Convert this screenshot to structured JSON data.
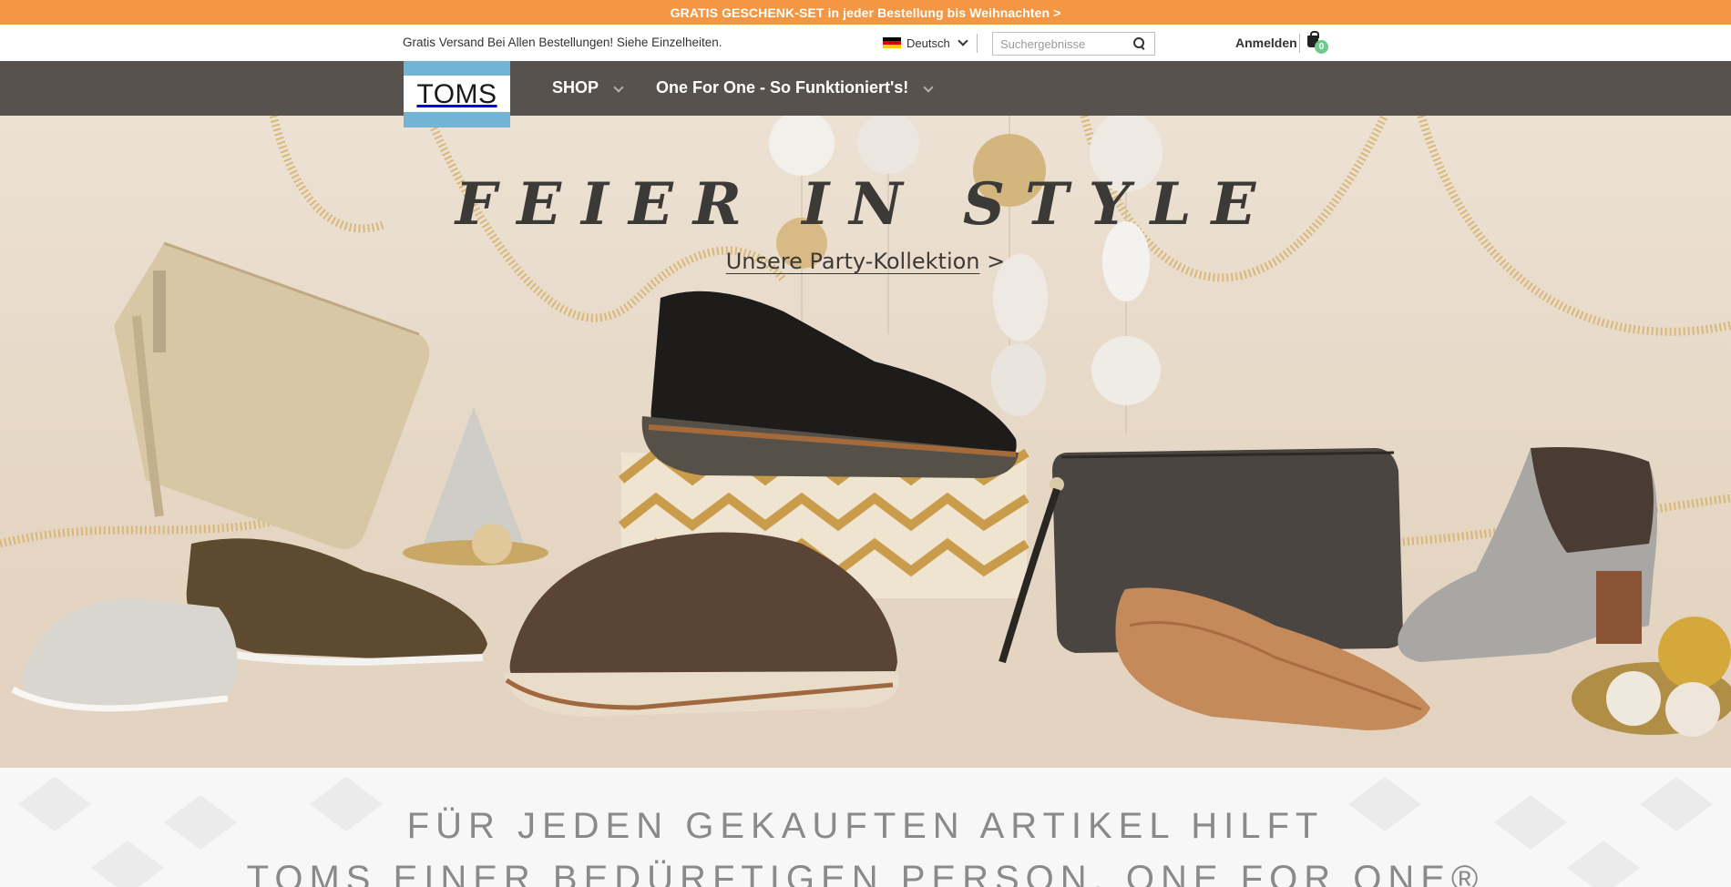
{
  "promo": {
    "text": "GRATIS GESCHENK-SET in jeder Bestellung bis Weihnachten >"
  },
  "utility": {
    "shipping_text": "Gratis Versand Bei Allen Bestellungen! Siehe Einzelheiten.",
    "language": "Deutsch",
    "search_placeholder": "Suchergebnisse",
    "sign_in": "Anmelden",
    "cart_count": "0"
  },
  "nav": {
    "logo_text": "TOMS",
    "items": [
      {
        "label": "SHOP"
      },
      {
        "label": "One For One - So Funktioniert's!"
      }
    ]
  },
  "hero": {
    "title": "FEIER IN STYLE",
    "link_text": "Unsere Party-Kollektion",
    "link_suffix": " >"
  },
  "mission": {
    "line1": "FÜR JEDEN GEKAUFTEN ARTIKEL HILFT",
    "line2": "TOMS EINER BEDÜRFTIGEN PERSON. ONE FOR ONE®"
  },
  "colors": {
    "promo_bg": "#f39744",
    "nav_bg": "#57524d",
    "logo_blue": "#73b4d6",
    "cart_badge": "#6ccc8a"
  }
}
